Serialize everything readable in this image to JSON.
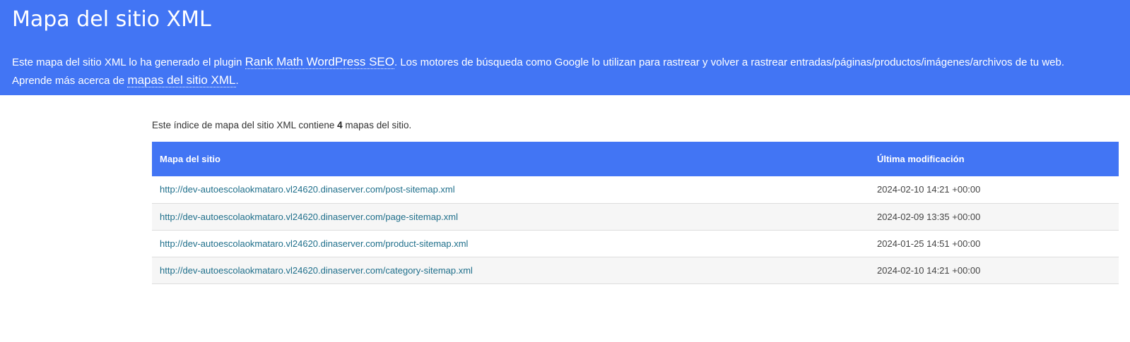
{
  "header": {
    "title": "Mapa del sitio XML",
    "intro_part1": "Este mapa del sitio XML lo ha generado el plugin ",
    "plugin_link": "Rank Math WordPress SEO",
    "intro_part2": ". Los motores de búsqueda como Google lo utilizan para rastrear y volver a rastrear entradas/páginas/productos/imágenes/archivos de tu web.",
    "learn_part1": "Aprende más acerca de ",
    "learn_link": "mapas del sitio XML",
    "learn_part2": "."
  },
  "summary": {
    "prefix": "Este índice de mapa del sitio XML contiene ",
    "count": "4",
    "suffix": " mapas del sitio."
  },
  "table": {
    "headers": {
      "sitemap": "Mapa del sitio",
      "lastmod": "Última modificación"
    },
    "rows": [
      {
        "url": "http://dev-autoescolaokmataro.vl24620.dinaserver.com/post-sitemap.xml",
        "date": "2024-02-10 14:21 +00:00"
      },
      {
        "url": "http://dev-autoescolaokmataro.vl24620.dinaserver.com/page-sitemap.xml",
        "date": "2024-02-09 13:35 +00:00"
      },
      {
        "url": "http://dev-autoescolaokmataro.vl24620.dinaserver.com/product-sitemap.xml",
        "date": "2024-01-25 14:51 +00:00"
      },
      {
        "url": "http://dev-autoescolaokmataro.vl24620.dinaserver.com/category-sitemap.xml",
        "date": "2024-02-10 14:21 +00:00"
      }
    ]
  },
  "colors": {
    "accent": "#4275f4",
    "link": "#1f6f8b"
  }
}
